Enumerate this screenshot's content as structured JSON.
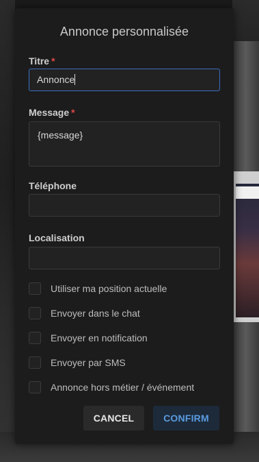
{
  "dialog": {
    "title": "Annonce personnalisée",
    "fields": {
      "titre": {
        "label": "Titre",
        "required_mark": "*",
        "value": "Annonce"
      },
      "message": {
        "label": "Message",
        "required_mark": "*",
        "value": "{message}"
      },
      "telephone": {
        "label": "Téléphone",
        "value": ""
      },
      "localisation": {
        "label": "Localisation",
        "value": ""
      }
    },
    "checkboxes": [
      {
        "label": "Utiliser ma position actuelle",
        "checked": false
      },
      {
        "label": "Envoyer dans le chat",
        "checked": false
      },
      {
        "label": "Envoyer en notification",
        "checked": false
      },
      {
        "label": "Envoyer par SMS",
        "checked": false
      },
      {
        "label": "Annonce hors métier / événement",
        "checked": false
      }
    ],
    "buttons": {
      "cancel": "CANCEL",
      "confirm": "CONFIRM"
    }
  },
  "colors": {
    "accent": "#3a6ec4",
    "required": "#e04848",
    "confirm_text": "#5a9be0",
    "dialog_bg": "#1c1c1c"
  }
}
